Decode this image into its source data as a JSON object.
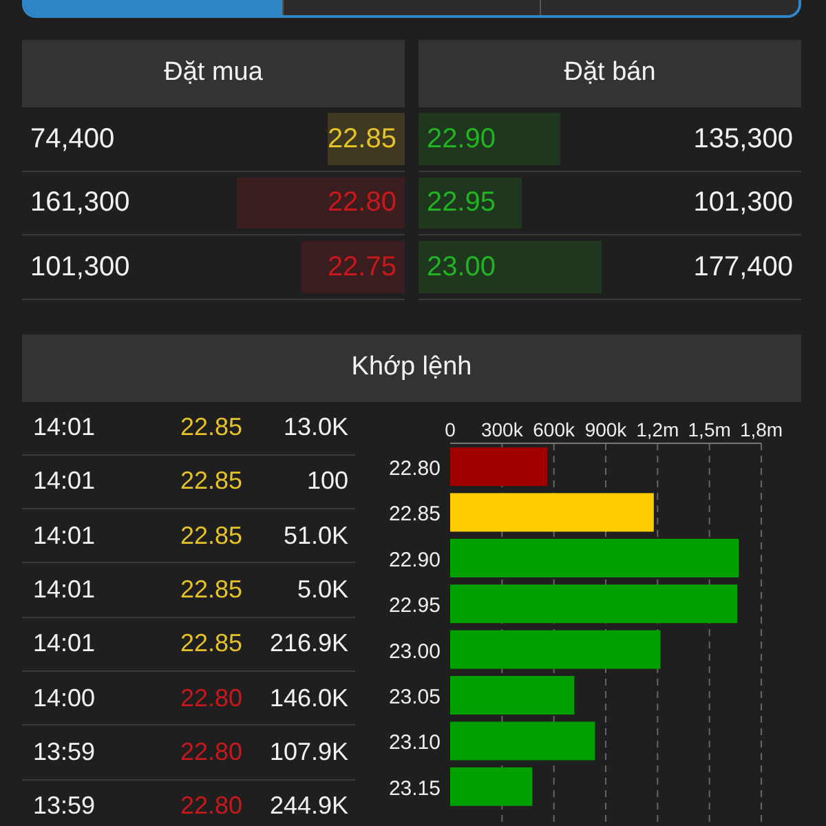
{
  "segmented_control": [
    {
      "selected": true
    },
    {
      "selected": false
    },
    {
      "selected": false
    }
  ],
  "order_book": {
    "bid_header": "Đặt mua",
    "ask_header": "Đặt bán",
    "rows": [
      {
        "bid": {
          "volume": "74,400",
          "price": "22.85",
          "color": "#e6c229",
          "level": 0.2
        },
        "ask": {
          "price": "22.90",
          "color": "#22b322",
          "level": 0.37,
          "volume": "135,300"
        }
      },
      {
        "bid": {
          "volume": "161,300",
          "price": "22.80",
          "color": "#c8181c",
          "level": 0.44
        },
        "ask": {
          "price": "22.95",
          "color": "#22b322",
          "level": 0.27,
          "volume": "101,300"
        }
      },
      {
        "bid": {
          "volume": "101,300",
          "price": "22.75",
          "color": "#c8181c",
          "level": 0.27
        },
        "ask": {
          "price": "23.00",
          "color": "#22b322",
          "level": 0.48,
          "volume": "177,400"
        }
      }
    ]
  },
  "matched": {
    "header": "Khớp lệnh",
    "trades": [
      {
        "time": "14:01",
        "price": "22.85",
        "color": "#e6c229",
        "volume": "13.0K"
      },
      {
        "time": "14:01",
        "price": "22.85",
        "color": "#e6c229",
        "volume": "100"
      },
      {
        "time": "14:01",
        "price": "22.85",
        "color": "#e6c229",
        "volume": "51.0K"
      },
      {
        "time": "14:01",
        "price": "22.85",
        "color": "#e6c229",
        "volume": "5.0K"
      },
      {
        "time": "14:01",
        "price": "22.85",
        "color": "#e6c229",
        "volume": "216.9K"
      },
      {
        "time": "14:00",
        "price": "22.80",
        "color": "#c8181c",
        "volume": "146.0K"
      },
      {
        "time": "13:59",
        "price": "22.80",
        "color": "#c8181c",
        "volume": "107.9K"
      },
      {
        "time": "13:59",
        "price": "22.80",
        "color": "#c8181c",
        "volume": "244.9K"
      }
    ],
    "chart_data": {
      "type": "bar",
      "orientation": "horizontal",
      "grid": true,
      "categories": [
        "22.80",
        "22.85",
        "22.90",
        "22.95",
        "23.00",
        "23.05",
        "23.10",
        "23.15"
      ],
      "series": [
        {
          "color": "#a00000",
          "values": [
            562000,
            null,
            null,
            null,
            null,
            null,
            null,
            null
          ]
        },
        {
          "color": "#ffcc00",
          "values": [
            null,
            1178000,
            null,
            null,
            null,
            null,
            null,
            null
          ]
        },
        {
          "color": "#00a000",
          "values": [
            null,
            null,
            1669000,
            1661000,
            1217000,
            718000,
            838000,
            475000
          ]
        }
      ],
      "xlim": [
        0,
        1800000
      ],
      "xticks": [
        {
          "value": 0,
          "label": "0"
        },
        {
          "value": 300000,
          "label": "300k"
        },
        {
          "value": 600000,
          "label": "600k"
        },
        {
          "value": 900000,
          "label": "900k"
        },
        {
          "value": 1200000,
          "label": "1,2m"
        },
        {
          "value": 1500000,
          "label": "1,5m"
        },
        {
          "value": 1800000,
          "label": "1,8m"
        }
      ]
    }
  }
}
